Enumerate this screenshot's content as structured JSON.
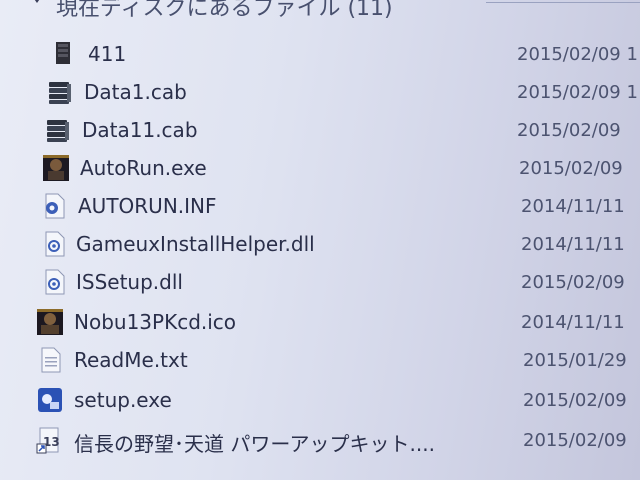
{
  "group": {
    "title": "現在ディスクにあるファイル (11)"
  },
  "files": [
    {
      "name": "411",
      "date": "2015/02/09 1",
      "icon": "folder-dark-icon"
    },
    {
      "name": "Data1.cab",
      "date": "2015/02/09 1",
      "icon": "cab-archive-icon"
    },
    {
      "name": "Data11.cab",
      "date": "2015/02/09",
      "icon": "cab-archive-icon"
    },
    {
      "name": "AutoRun.exe",
      "date": "2015/02/09",
      "icon": "game-exe-icon"
    },
    {
      "name": "AUTORUN.INF",
      "date": "2014/11/11",
      "icon": "settings-file-icon"
    },
    {
      "name": "GameuxInstallHelper.dll",
      "date": "2014/11/11",
      "icon": "dll-file-icon"
    },
    {
      "name": "ISSetup.dll",
      "date": "2015/02/09",
      "icon": "dll-file-icon"
    },
    {
      "name": "Nobu13PKcd.ico",
      "date": "2014/11/11",
      "icon": "game-ico-icon"
    },
    {
      "name": "ReadMe.txt",
      "date": "2015/01/29",
      "icon": "text-file-icon"
    },
    {
      "name": "setup.exe",
      "date": "2015/02/09",
      "icon": "setup-exe-icon"
    },
    {
      "name": "信長の野望･天道 パワーアップキット....",
      "date": "2015/02/09",
      "icon": "shortcut-icon"
    }
  ],
  "colors": {
    "text": "#2a2f4a",
    "date": "#4c5370",
    "accent": "#2b52b5"
  }
}
